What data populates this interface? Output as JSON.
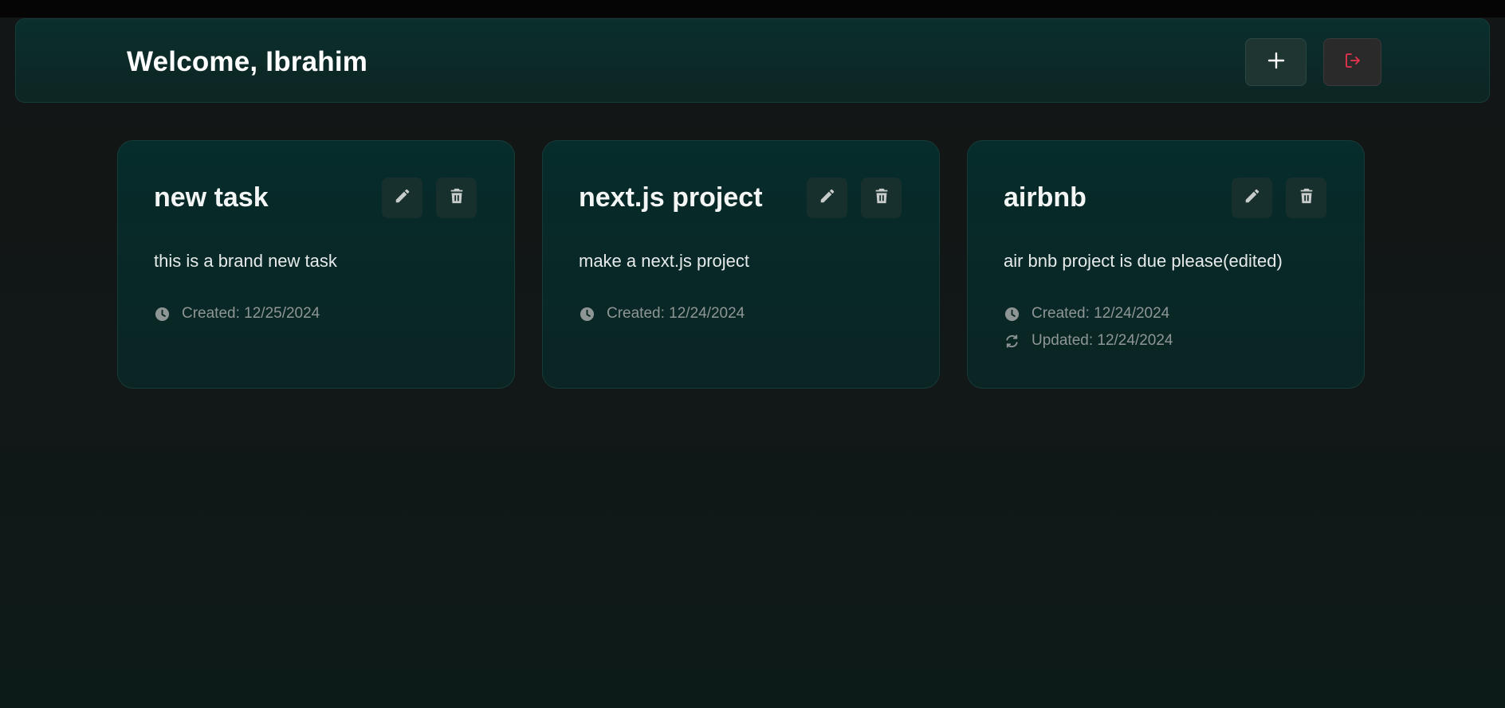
{
  "header": {
    "title": "Welcome, Ibrahim",
    "add_icon": "plus-icon",
    "logout_icon": "logout-icon"
  },
  "colors": {
    "accent": "#0a2f2d",
    "danger": "#e8344e",
    "muted_text": "#8e9695"
  },
  "tasks": [
    {
      "title": "new task",
      "description": "this is a brand new task",
      "created": "Created: 12/25/2024",
      "updated": null
    },
    {
      "title": "next.js project",
      "description": "make a next.js project",
      "created": "Created: 12/24/2024",
      "updated": null
    },
    {
      "title": "airbnb",
      "description": "air bnb project is due please(edited)",
      "created": "Created: 12/24/2024",
      "updated": "Updated: 12/24/2024"
    }
  ]
}
